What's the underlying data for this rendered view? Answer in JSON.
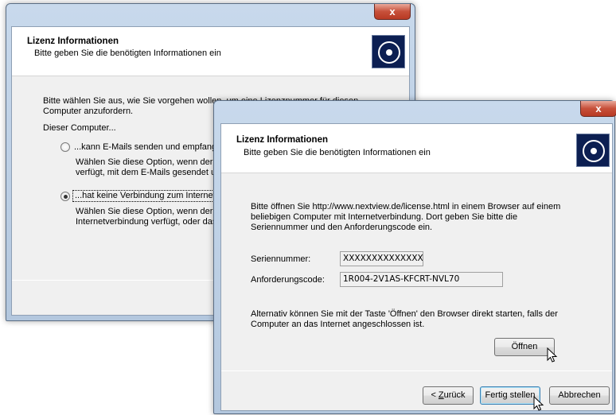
{
  "back_window": {
    "close_glyph": "x",
    "header_title": "Lizenz Informationen",
    "header_subtitle": "Bitte geben Sie die benötigten Informationen ein",
    "intro_line1": "Bitte wählen Sie aus, wie Sie vorgehen wollen, um eine Lizenznummer für diesen",
    "intro_line2": "Computer anzufordern.",
    "dieser_computer": "Dieser Computer...",
    "option1_label": "...kann E-Mails senden und empfang",
    "option1_desc1": "Wählen Sie diese Option, wenn der C",
    "option1_desc2": "verfügt, mit dem E-Mails gesendet ur",
    "option2_label": "...hat keine Verbindung zum Internet.",
    "option2_desc1": "Wählen Sie diese Option, wenn der C",
    "option2_desc2": "Internetverbindung verfügt, oder das",
    "selected_option": 2
  },
  "front_window": {
    "close_glyph": "x",
    "header_title": "Lizenz Informationen",
    "header_subtitle": "Bitte geben Sie die benötigten Informationen ein",
    "info_line1": "Bitte öffnen Sie http://www.nextview.de/license.html in einem Browser auf einem",
    "info_line2": "beliebigen Computer mit Internetverbindung. Dort geben Sie bitte die",
    "info_line3": "Seriennummer und den Anforderungscode ein.",
    "serial_label": "Seriennummer:",
    "serial_value": "XXXXXXXXXXXXXXXXX",
    "request_label": "Anforderungscode:",
    "request_value": "1R004-2V1AS-KFCRT-NVL70",
    "alt_line1": "Alternativ können Sie mit der Taste 'Öffnen' den Browser direkt starten, falls der",
    "alt_line2": "Computer an das Internet angeschlossen ist.",
    "open_button": "Öffnen",
    "back_prefix": "< ",
    "back_hotkey": "Z",
    "back_rest": "urück",
    "finish_button": "Fertig stellen",
    "cancel_button": "Abbrechen"
  }
}
